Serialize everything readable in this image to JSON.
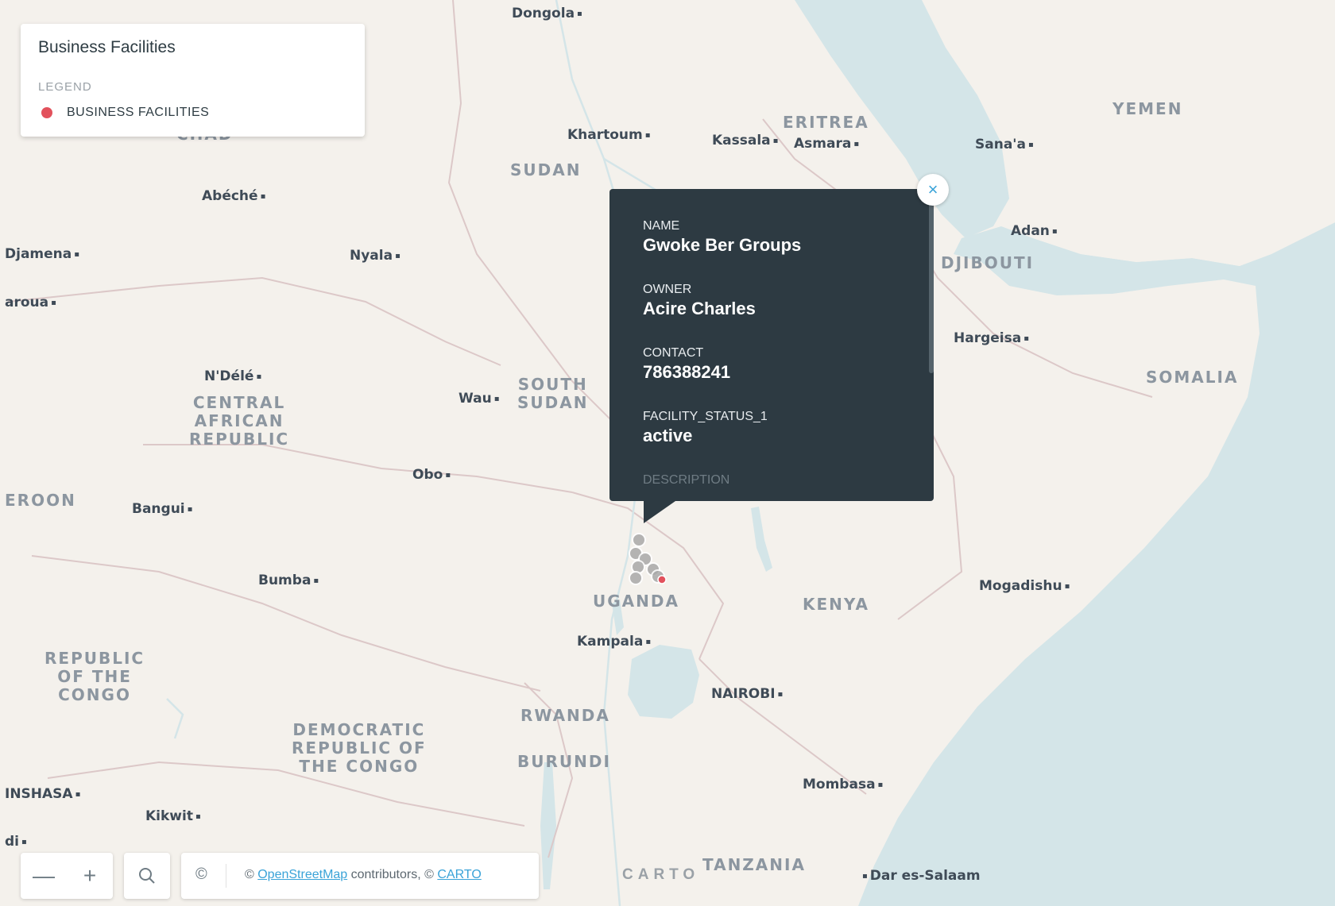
{
  "map": {
    "colors": {
      "land": "#f4f1ec",
      "water": "#d4e5e8",
      "border": "#dcc8c8",
      "marker": "#a9a9a9",
      "marker_selected": "#e2515c"
    },
    "countries": [
      {
        "name": "CHAD"
      },
      {
        "name": "SUDAN"
      },
      {
        "name": "ERITREA"
      },
      {
        "name": "YEMEN"
      },
      {
        "name": "DJIBOUTI"
      },
      {
        "name": "SOMALIA"
      },
      {
        "name": "SOUTH\nSUDAN"
      },
      {
        "name": "CENTRAL\nAFRICAN\nREPUBLIC"
      },
      {
        "name": "EROON"
      },
      {
        "name": "UGANDA"
      },
      {
        "name": "KENYA"
      },
      {
        "name": "REPUBLIC\nOF THE\nCONGO"
      },
      {
        "name": "DEMOCRATIC\nREPUBLIC OF\nTHE CONGO"
      },
      {
        "name": "RWANDA"
      },
      {
        "name": "BURUNDI"
      },
      {
        "name": "TANZANIA"
      }
    ],
    "places": [
      {
        "name": "Dongola"
      },
      {
        "name": "Khartoum"
      },
      {
        "name": "Kassala"
      },
      {
        "name": "Asmara"
      },
      {
        "name": "Sana'a"
      },
      {
        "name": "Adan"
      },
      {
        "name": "Abéché"
      },
      {
        "name": "Djamena"
      },
      {
        "name": "Nyala"
      },
      {
        "name": "aroua"
      },
      {
        "name": "Hargeisa"
      },
      {
        "name": "N'Délé"
      },
      {
        "name": "Wau"
      },
      {
        "name": "Obo"
      },
      {
        "name": "Bangui"
      },
      {
        "name": "Bumba"
      },
      {
        "name": "Mogadishu"
      },
      {
        "name": "Kampala"
      },
      {
        "name": "NAIROBI"
      },
      {
        "name": "INSHASA"
      },
      {
        "name": "Kikwit"
      },
      {
        "name": "di"
      },
      {
        "name": "Mombasa"
      },
      {
        "name": "Dar es-Salaam"
      }
    ]
  },
  "legend": {
    "title": "Business Facilities",
    "subtitle": "LEGEND",
    "item": "BUSINESS FACILITIES"
  },
  "popup": {
    "fields": [
      {
        "label": "NAME",
        "value": "Gwoke Ber Groups"
      },
      {
        "label": "OWNER",
        "value": "Acire Charles"
      },
      {
        "label": "CONTACT",
        "value": "786388241"
      },
      {
        "label": "FACILITY_STATUS_1",
        "value": "active"
      }
    ],
    "next_label": "DESCRIPTION",
    "close_icon": "×"
  },
  "controls": {
    "zoom_out": "—",
    "zoom_in": "+",
    "search_icon": "🔍",
    "attribution_icon": "©",
    "attribution_prefix": "© ",
    "attribution_osm": "OpenStreetMap",
    "attribution_mid": " contributors, © ",
    "attribution_carto": "CARTO"
  },
  "carto_logo": "CARTO"
}
